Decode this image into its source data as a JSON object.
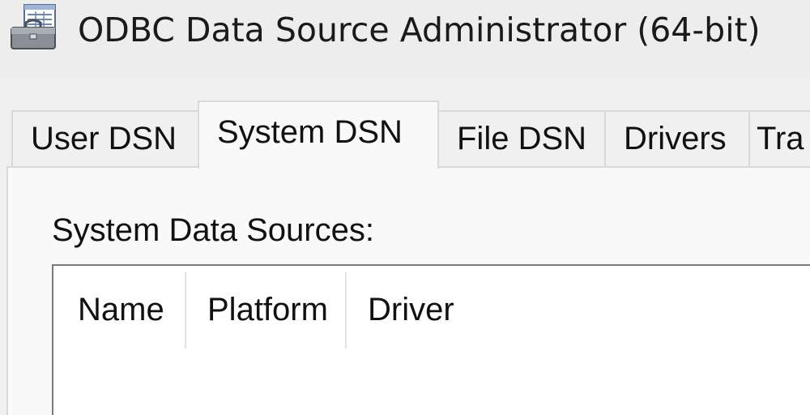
{
  "window": {
    "title": "ODBC Data Source Administrator (64-bit)",
    "icon": "odbc-admin-icon"
  },
  "tabs": [
    {
      "label": "User DSN",
      "active": false
    },
    {
      "label": "System DSN",
      "active": true
    },
    {
      "label": "File DSN",
      "active": false
    },
    {
      "label": "Drivers",
      "active": false
    },
    {
      "label": "Tra",
      "active": false
    }
  ],
  "panel": {
    "section_label": "System Data Sources:",
    "list": {
      "columns": [
        "Name",
        "Platform",
        "Driver"
      ],
      "rows": []
    }
  }
}
